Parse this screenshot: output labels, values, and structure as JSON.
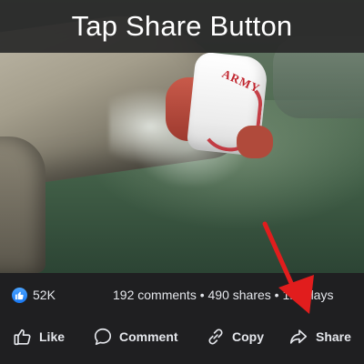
{
  "overlay": {
    "title": "Tap Share Button",
    "arrow_color": "#e11d1d"
  },
  "video": {
    "shirt_text": "ARMY"
  },
  "stats": {
    "like_count": "52K",
    "summary": "192 comments • 490 shares • 1M plays",
    "like_badge_icon": "thumbs-up-icon",
    "like_badge_color": "#1877f2"
  },
  "actions": [
    {
      "label": "Like",
      "icon": "thumbs-up-outline-icon"
    },
    {
      "label": "Comment",
      "icon": "speech-bubble-icon"
    },
    {
      "label": "Copy",
      "icon": "link-icon"
    },
    {
      "label": "Share",
      "icon": "share-arrow-icon"
    }
  ],
  "colors": {
    "background": "#1f1f21",
    "text": "#e4e6eb"
  }
}
